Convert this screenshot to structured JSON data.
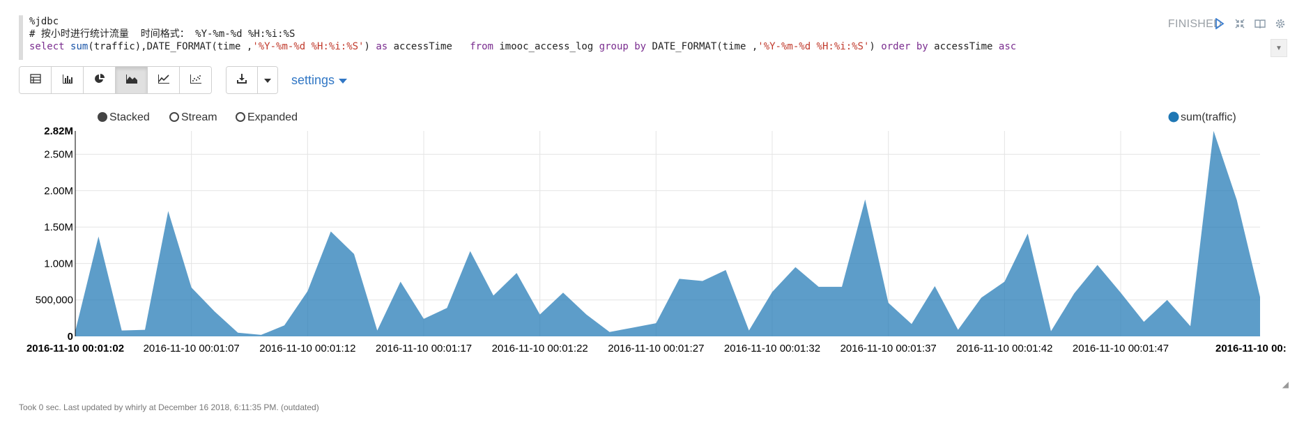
{
  "editor": {
    "line1": "%jdbc",
    "line2": "# 按小时进行统计流量  时间格式： %Y-%m-%d %H:%i:%S",
    "line3_tokens": [
      {
        "t": "select",
        "c": "kw"
      },
      {
        "t": " ",
        "c": "plain"
      },
      {
        "t": "sum",
        "c": "fn"
      },
      {
        "t": "(traffic),DATE_FORMAT(time ,",
        "c": "plain"
      },
      {
        "t": "'%Y-%m-%d %H:%i:%S'",
        "c": "str"
      },
      {
        "t": ") ",
        "c": "plain"
      },
      {
        "t": "as",
        "c": "kw"
      },
      {
        "t": " accessTime   ",
        "c": "plain"
      },
      {
        "t": "from",
        "c": "kw"
      },
      {
        "t": " imooc_access_log ",
        "c": "plain"
      },
      {
        "t": "group",
        "c": "kw"
      },
      {
        "t": " ",
        "c": "plain"
      },
      {
        "t": "by",
        "c": "kw"
      },
      {
        "t": " DATE_FORMAT(time ,",
        "c": "plain"
      },
      {
        "t": "'%Y-%m-%d %H:%i:%S'",
        "c": "str"
      },
      {
        "t": ") ",
        "c": "plain"
      },
      {
        "t": "order",
        "c": "kw"
      },
      {
        "t": " ",
        "c": "plain"
      },
      {
        "t": "by",
        "c": "kw"
      },
      {
        "t": " accessTime ",
        "c": "plain"
      },
      {
        "t": "asc",
        "c": "kw"
      }
    ]
  },
  "status": "FINISHED",
  "settings_label": "settings",
  "viz_buttons": [
    "table-icon",
    "bar-chart-icon",
    "pie-chart-icon",
    "area-chart-icon",
    "line-chart-icon",
    "scatter-chart-icon"
  ],
  "active_viz": "area-chart-icon",
  "footer": "Took 0 sec. Last updated by whirly at December 16 2018, 6:11:35 PM. (outdated)",
  "chart_data": {
    "type": "area",
    "stack_options": [
      {
        "label": "Stacked",
        "selected": true
      },
      {
        "label": "Stream",
        "selected": false
      },
      {
        "label": "Expanded",
        "selected": false
      }
    ],
    "series": [
      {
        "name": "sum(traffic)",
        "color": "#1f77b4",
        "values": [
          70000,
          1370000,
          80000,
          90000,
          1720000,
          670000,
          340000,
          50000,
          20000,
          150000,
          620000,
          1440000,
          1130000,
          80000,
          750000,
          240000,
          390000,
          1170000,
          560000,
          870000,
          300000,
          600000,
          300000,
          60000,
          120000,
          180000,
          790000,
          760000,
          910000,
          80000,
          610000,
          950000,
          680000,
          680000,
          1880000,
          460000,
          170000,
          690000,
          90000,
          530000,
          750000,
          1410000,
          70000,
          590000,
          980000,
          600000,
          200000,
          500000,
          140000,
          2820000,
          1870000,
          540000
        ]
      }
    ],
    "x_first_second": 2,
    "x_last_second": 53,
    "x_tick_labels": [
      {
        "sec": 2,
        "label": "2016-11-10 00:01:02",
        "bold": true
      },
      {
        "sec": 7,
        "label": "2016-11-10 00:01:07",
        "bold": false
      },
      {
        "sec": 12,
        "label": "2016-11-10 00:01:12",
        "bold": false
      },
      {
        "sec": 17,
        "label": "2016-11-10 00:01:17",
        "bold": false
      },
      {
        "sec": 22,
        "label": "2016-11-10 00:01:22",
        "bold": false
      },
      {
        "sec": 27,
        "label": "2016-11-10 00:01:27",
        "bold": false
      },
      {
        "sec": 32,
        "label": "2016-11-10 00:01:32",
        "bold": false
      },
      {
        "sec": 37,
        "label": "2016-11-10 00:01:37",
        "bold": false
      },
      {
        "sec": 42,
        "label": "2016-11-10 00:01:42",
        "bold": false
      },
      {
        "sec": 47,
        "label": "2016-11-10 00:01:47",
        "bold": false
      },
      {
        "sec": 53,
        "label": "2016-11-10 00:",
        "bold": true
      }
    ],
    "y_ticks": [
      {
        "v": 0,
        "label": "0",
        "bold": true
      },
      {
        "v": 500000,
        "label": "500,000",
        "bold": false
      },
      {
        "v": 1000000,
        "label": "1.00M",
        "bold": false
      },
      {
        "v": 1500000,
        "label": "1.50M",
        "bold": false
      },
      {
        "v": 2000000,
        "label": "2.00M",
        "bold": false
      },
      {
        "v": 2500000,
        "label": "2.50M",
        "bold": false
      },
      {
        "v": 2820000,
        "label": "2.82M",
        "bold": true
      }
    ],
    "ylim": [
      0,
      2820000
    ],
    "grid": true,
    "legend_position": "top-right"
  }
}
